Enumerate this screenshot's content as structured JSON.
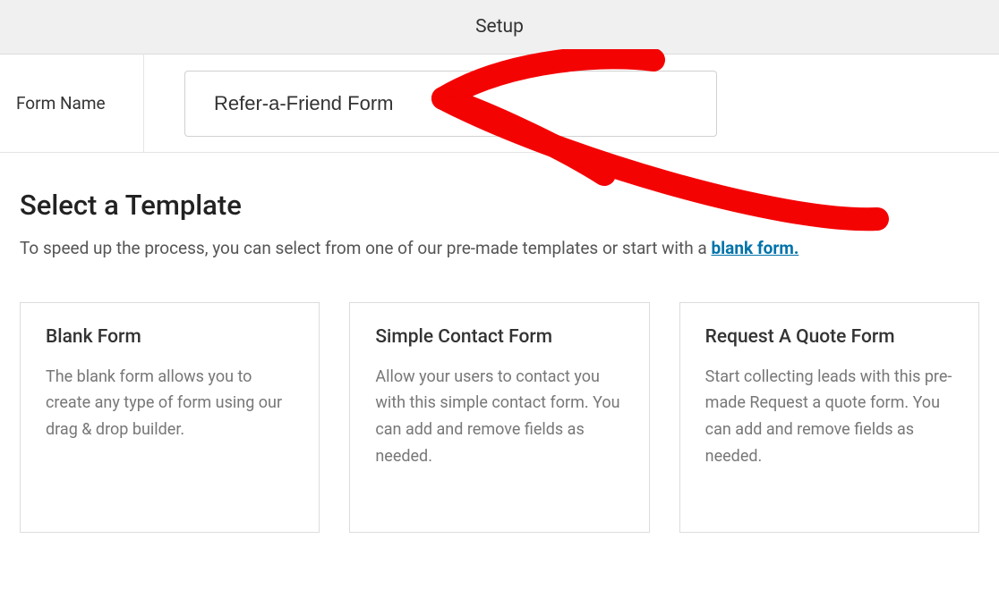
{
  "header": {
    "title": "Setup"
  },
  "form_name": {
    "label": "Form Name",
    "value": "Refer-a-Friend Form"
  },
  "template_section": {
    "heading": "Select a Template",
    "subtext_prefix": "To speed up the process, you can select from one of our pre-made templates or start with a ",
    "subtext_link": "blank form."
  },
  "templates": [
    {
      "title": "Blank Form",
      "desc": "The blank form allows you to create any type of form using our drag & drop builder."
    },
    {
      "title": "Simple Contact Form",
      "desc": "Allow your users to contact you with this simple contact form. You can add and remove fields as needed."
    },
    {
      "title": "Request A Quote Form",
      "desc": "Start collecting leads with this pre-made Request a quote form. You can add and remove fields as needed."
    }
  ]
}
